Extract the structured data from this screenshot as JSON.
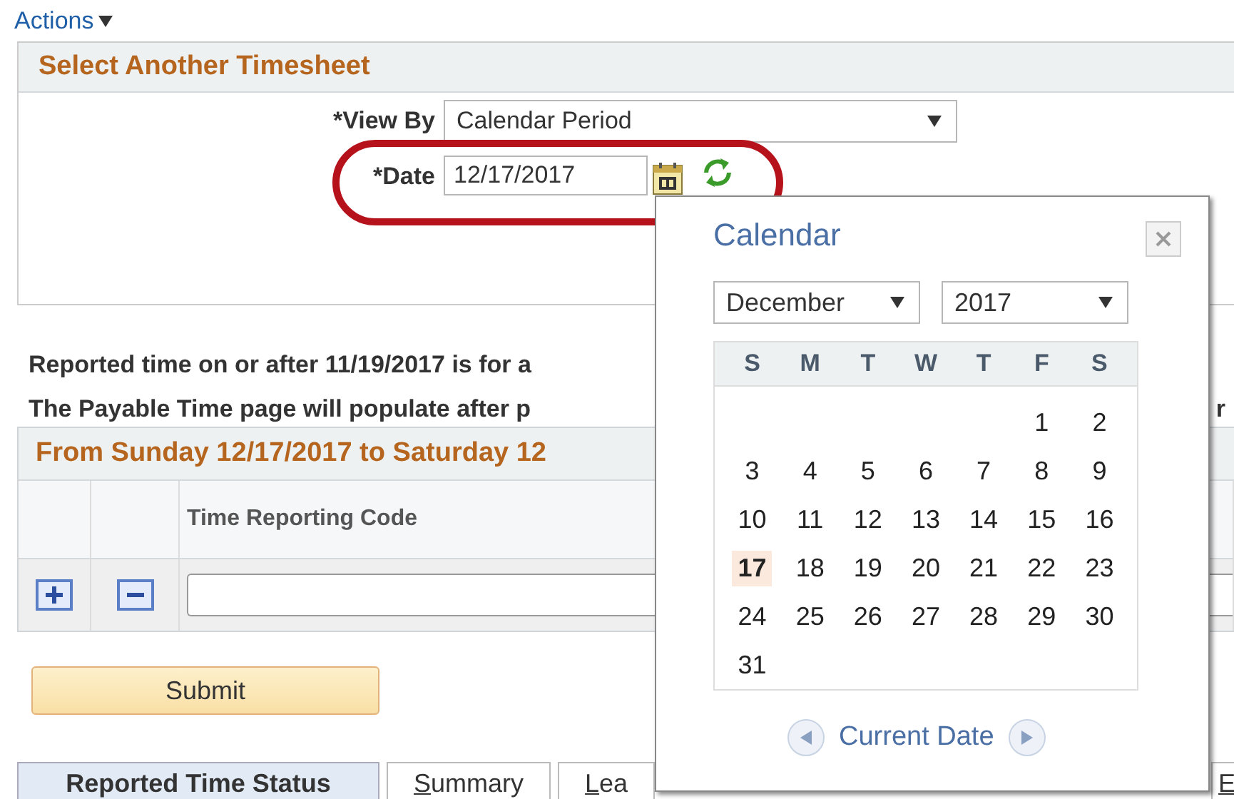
{
  "actions_menu": {
    "label": "Actions"
  },
  "timesheet_panel": {
    "title": "Select Another Timesheet",
    "view_by": {
      "label": "*View By",
      "value": "Calendar Period"
    },
    "date": {
      "label": "*Date",
      "value": "12/17/2017",
      "highlighted": true
    }
  },
  "messages": [
    {
      "text": "Reported time on or after **11/19/2017** is for a"
    },
    {
      "text": "The Payable Time page will populate after p",
      "tail": "r"
    }
  ],
  "time_grid": {
    "title": "From Sunday 12/17/2017 to Saturday 12",
    "columns": [
      "Time Reporting Code"
    ],
    "rows": [
      {
        "code": ""
      }
    ]
  },
  "submit_button": {
    "label": "Submit"
  },
  "tabs": [
    {
      "label": "Reported Time Status",
      "selected": true
    },
    {
      "label": "Summary",
      "selected": false
    },
    {
      "label": "Lea",
      "selected": false
    },
    {
      "label": "E",
      "selected": false
    }
  ],
  "calendar": {
    "title": "Calendar",
    "month": "December",
    "year": "2017",
    "weekdays": [
      "S",
      "M",
      "T",
      "W",
      "T",
      "F",
      "S"
    ],
    "weeks": [
      {
        "starts_mid_week": true,
        "days": [
          {
            "day": "1",
            "selected": false
          },
          {
            "day": "2",
            "selected": false
          }
        ]
      },
      {
        "days": [
          {
            "day": "3",
            "selected": false
          },
          {
            "day": "4",
            "selected": false
          },
          {
            "day": "5",
            "selected": false
          },
          {
            "day": "6",
            "selected": false
          },
          {
            "day": "7",
            "selected": false
          },
          {
            "day": "8",
            "selected": false
          },
          {
            "day": "9",
            "selected": false
          }
        ]
      },
      {
        "days": [
          {
            "day": "10",
            "selected": false
          },
          {
            "day": "11",
            "selected": false
          },
          {
            "day": "12",
            "selected": false
          },
          {
            "day": "13",
            "selected": false
          },
          {
            "day": "14",
            "selected": false
          },
          {
            "day": "15",
            "selected": false
          },
          {
            "day": "16",
            "selected": false
          }
        ]
      },
      {
        "days": [
          {
            "day": "17",
            "selected": true
          },
          {
            "day": "18",
            "selected": false
          },
          {
            "day": "19",
            "selected": false
          },
          {
            "day": "20",
            "selected": false
          },
          {
            "day": "21",
            "selected": false
          },
          {
            "day": "22",
            "selected": false
          },
          {
            "day": "23",
            "selected": false
          }
        ]
      },
      {
        "days": [
          {
            "day": "24",
            "selected": false
          },
          {
            "day": "25",
            "selected": false
          },
          {
            "day": "26",
            "selected": false
          },
          {
            "day": "27",
            "selected": false
          },
          {
            "day": "28",
            "selected": false
          },
          {
            "day": "29",
            "selected": false
          },
          {
            "day": "30",
            "selected": false
          }
        ]
      },
      {
        "days": [
          {
            "day": "31",
            "selected": false
          }
        ]
      }
    ],
    "footer": {
      "label": "Current Date"
    }
  }
}
